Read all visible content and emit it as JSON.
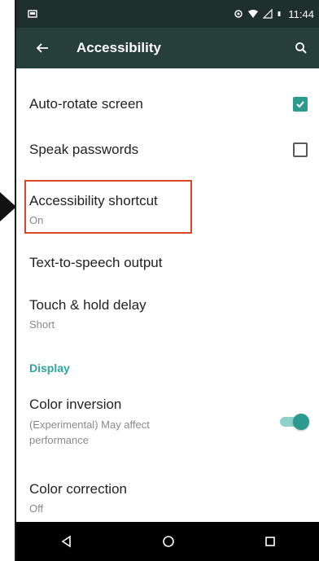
{
  "status_bar": {
    "time": "11:44"
  },
  "toolbar": {
    "title": "Accessibility"
  },
  "settings": {
    "auto_rotate": {
      "label": "Auto-rotate screen",
      "checked": true
    },
    "speak_passwords": {
      "label": "Speak passwords",
      "checked": false
    },
    "accessibility_shortcut": {
      "label": "Accessibility shortcut",
      "value": "On"
    },
    "tts_output": {
      "label": "Text-to-speech output"
    },
    "touch_hold": {
      "label": "Touch & hold delay",
      "value": "Short"
    },
    "display_header": "Display",
    "color_inversion": {
      "label": "Color inversion",
      "desc": "(Experimental) May affect performance",
      "enabled": true
    },
    "color_correction": {
      "label": "Color correction",
      "value": "Off"
    }
  },
  "colors": {
    "accent": "#2c9a8f",
    "toolbar": "#263f3a",
    "status_bar": "#1f2f2c",
    "highlight": "#d9472b"
  }
}
